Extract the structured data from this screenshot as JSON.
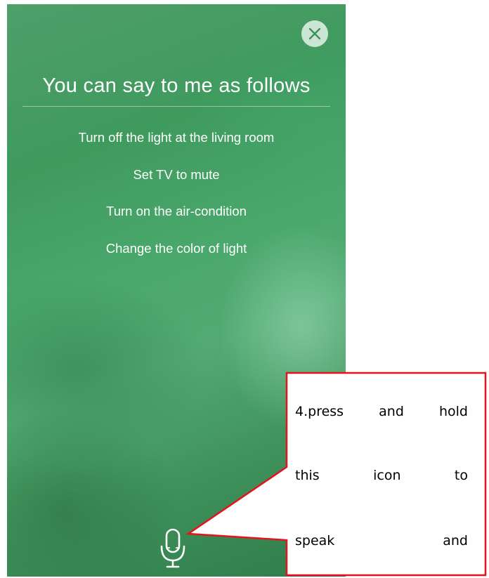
{
  "voice_assistant": {
    "title": "You can say to me as follows",
    "suggestions": [
      "Turn off the light at the living room",
      "Set TV to mute",
      "Turn on the air-condition",
      "Change the color of light"
    ],
    "close_icon": "close-icon",
    "mic_icon": "microphone-icon"
  },
  "annotation": {
    "lines": [
      [
        "4.press",
        "and",
        "hold"
      ],
      [
        "this",
        "icon",
        "to"
      ],
      [
        "speak",
        "and"
      ]
    ],
    "border_color": "#e3141b"
  }
}
